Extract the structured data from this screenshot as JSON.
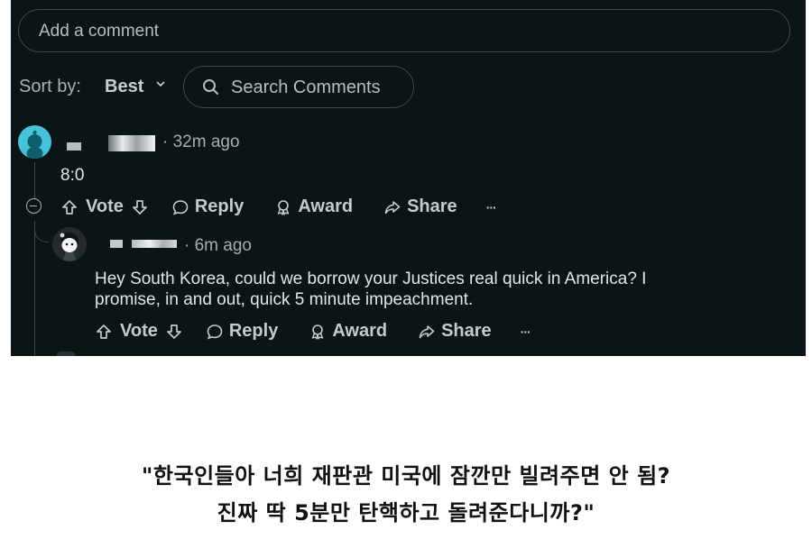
{
  "comment_input": {
    "placeholder": "Add a comment"
  },
  "sort": {
    "label": "Sort by:",
    "value": "Best",
    "chevron": "⌄"
  },
  "search": {
    "placeholder": "Search Comments",
    "icon": "search-icon"
  },
  "comments": [
    {
      "age": "· 32m ago",
      "body": "8:0",
      "actions": {
        "vote": "Vote",
        "reply": "Reply",
        "award": "Award",
        "share": "Share",
        "more": "···"
      }
    },
    {
      "age": "· 6m ago",
      "body_line1": "Hey South Korea, could we borrow your Justices real quick in America? I",
      "body_line2": "promise, in and out, quick 5 minute impeachment.",
      "actions": {
        "vote": "Vote",
        "reply": "Reply",
        "award": "Award",
        "share": "Share",
        "more": "···"
      }
    }
  ],
  "caption": {
    "line1": "\"한국인들아 너희 재판관 미국에 잠깐만 빌려주면 안 됨?",
    "line2": "진짜 딱 5분만 탄핵하고 돌려준다니까?\""
  },
  "colors": {
    "background": "#0b1416",
    "text": "#d7dadc",
    "avatar_teal": "#46c3d9"
  }
}
